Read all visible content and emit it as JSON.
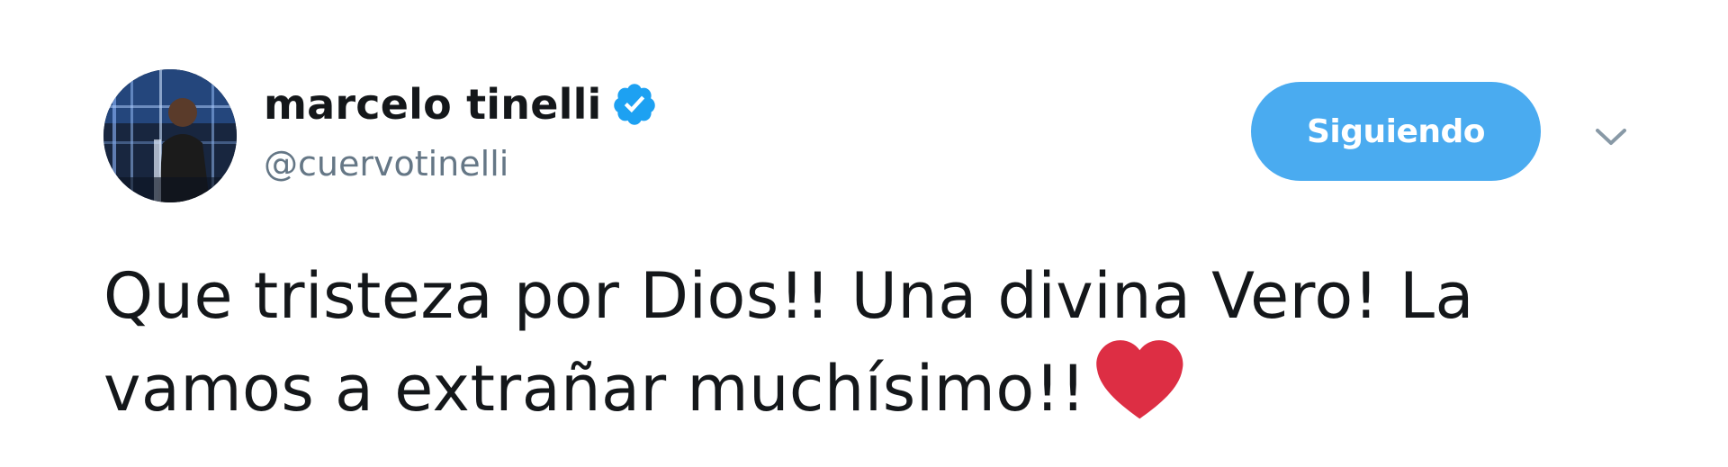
{
  "author": {
    "display_name": "marcelo tinelli",
    "handle": "@cuervotinelli",
    "verified": true,
    "avatar_icon": "profile-photo"
  },
  "follow_button": {
    "label": "Siguiendo",
    "color": "#4aabf0"
  },
  "menu": {
    "icon": "chevron-down-icon"
  },
  "tweet": {
    "line1": "Que tristeza por Dios!! Una divina Vero! La",
    "line2": "vamos a extrañar muchísimo!!",
    "emoji": "red-heart-icon",
    "emoji_color": "#dd2e44"
  },
  "colors": {
    "text": "#14171a",
    "secondary": "#657786",
    "verified": "#1da1f2"
  }
}
